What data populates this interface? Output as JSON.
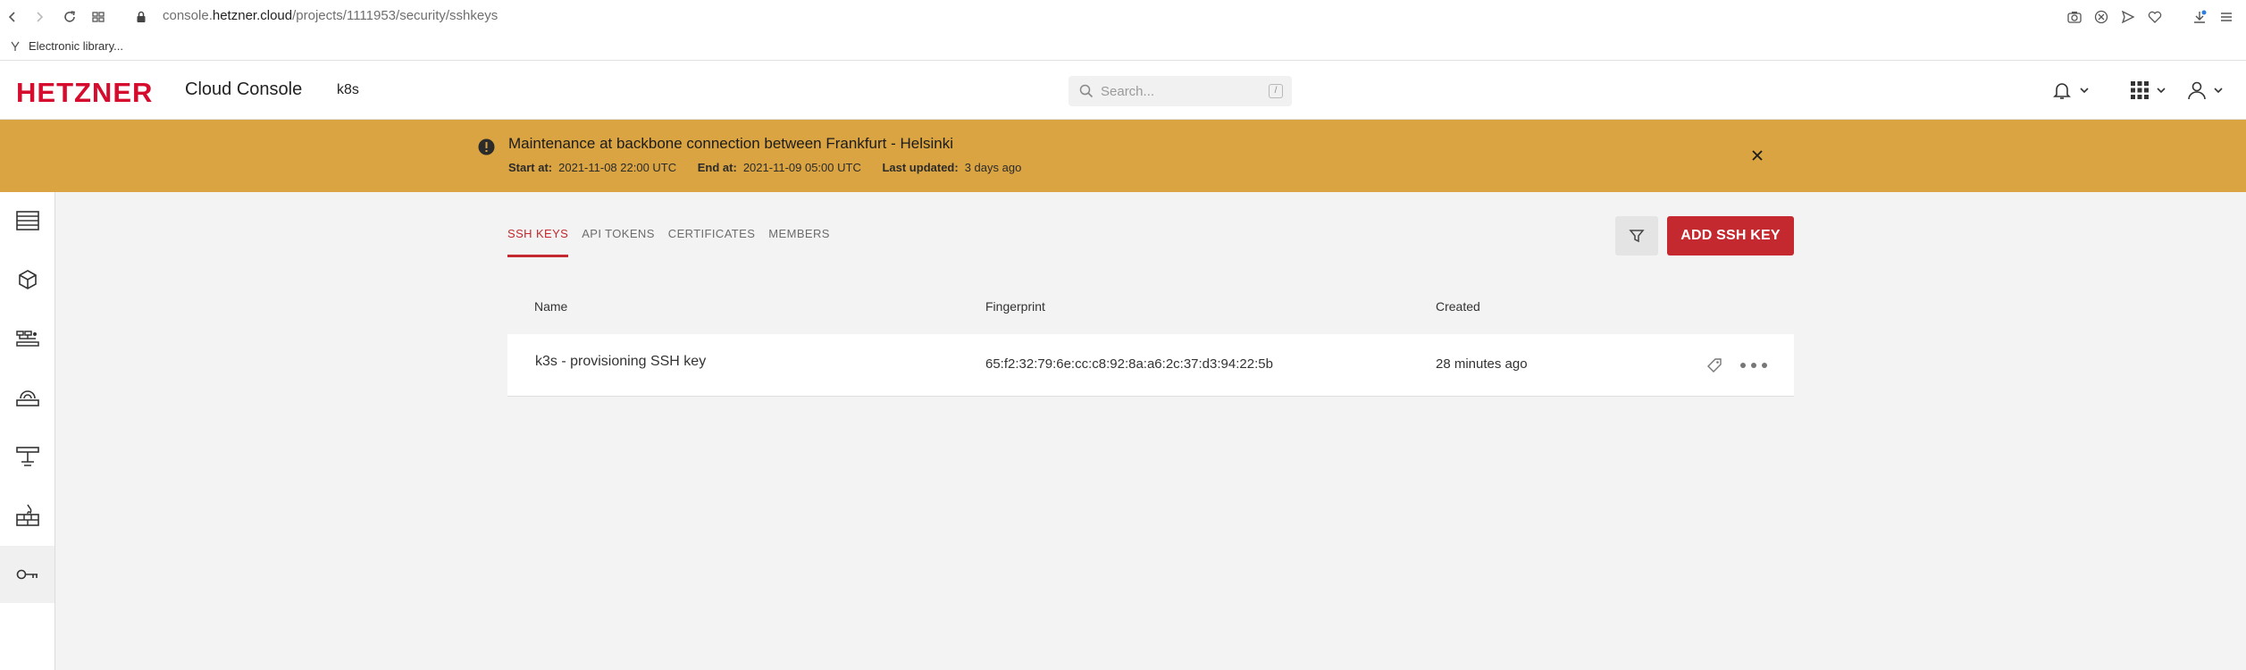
{
  "browser": {
    "url_prefix": "console.",
    "url_domain": "hetzner.cloud",
    "url_path": "/projects/1111953/security/sshkeys",
    "bookmark_label": "Electronic library..."
  },
  "header": {
    "logo": "HETZNER",
    "app_title": "Cloud Console",
    "project": "k8s",
    "search_placeholder": "Search...",
    "search_shortcut": "/"
  },
  "banner": {
    "title": "Maintenance at backbone connection between Frankfurt - Helsinki",
    "start_label": "Start at:",
    "start_value": "2021-11-08 22:00 UTC",
    "end_label": "End at:",
    "end_value": "2021-11-09 05:00 UTC",
    "updated_label": "Last updated:",
    "updated_value": "3 days ago",
    "color": "#d9a441"
  },
  "tabs": [
    {
      "label": "SSH KEYS",
      "active": true
    },
    {
      "label": "API TOKENS",
      "active": false
    },
    {
      "label": "CERTIFICATES",
      "active": false
    },
    {
      "label": "MEMBERS",
      "active": false
    }
  ],
  "actions": {
    "add_label": "ADD SSH KEY",
    "accent": "#c3292f"
  },
  "table": {
    "columns": [
      "Name",
      "Fingerprint",
      "Created"
    ],
    "rows": [
      {
        "name": "k3s - provisioning SSH key",
        "fingerprint": "65:f2:32:79:6e:cc:c8:92:8a:a6:2c:37:d3:94:22:5b",
        "created": "28 minutes ago"
      }
    ]
  },
  "sidebar": {
    "items": [
      {
        "icon": "servers-icon"
      },
      {
        "icon": "volumes-icon"
      },
      {
        "icon": "load-balancers-icon"
      },
      {
        "icon": "floating-ips-icon"
      },
      {
        "icon": "networks-icon"
      },
      {
        "icon": "firewalls-icon"
      },
      {
        "icon": "security-key-icon",
        "active": true
      }
    ]
  }
}
